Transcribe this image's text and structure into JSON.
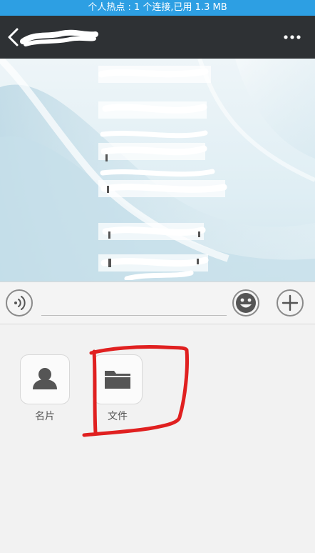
{
  "status_bar": {
    "text": "个人热点 : 1 个连接,已用 1.3 MB"
  },
  "title_bar": {
    "back_icon": "chevron-left-icon",
    "more_icon": "more-dots-icon"
  },
  "input_bar": {
    "voice_icon": "voice-icon",
    "emoji_icon": "smiley-icon",
    "plus_icon": "plus-icon",
    "text_value": ""
  },
  "tools": [
    {
      "label": "名片",
      "icon": "contact-card-icon"
    },
    {
      "label": "文件",
      "icon": "folder-icon"
    }
  ],
  "colors": {
    "status_bar": "#2d9fe3",
    "title_bar": "#2e3134",
    "annotation": "#e02020"
  }
}
